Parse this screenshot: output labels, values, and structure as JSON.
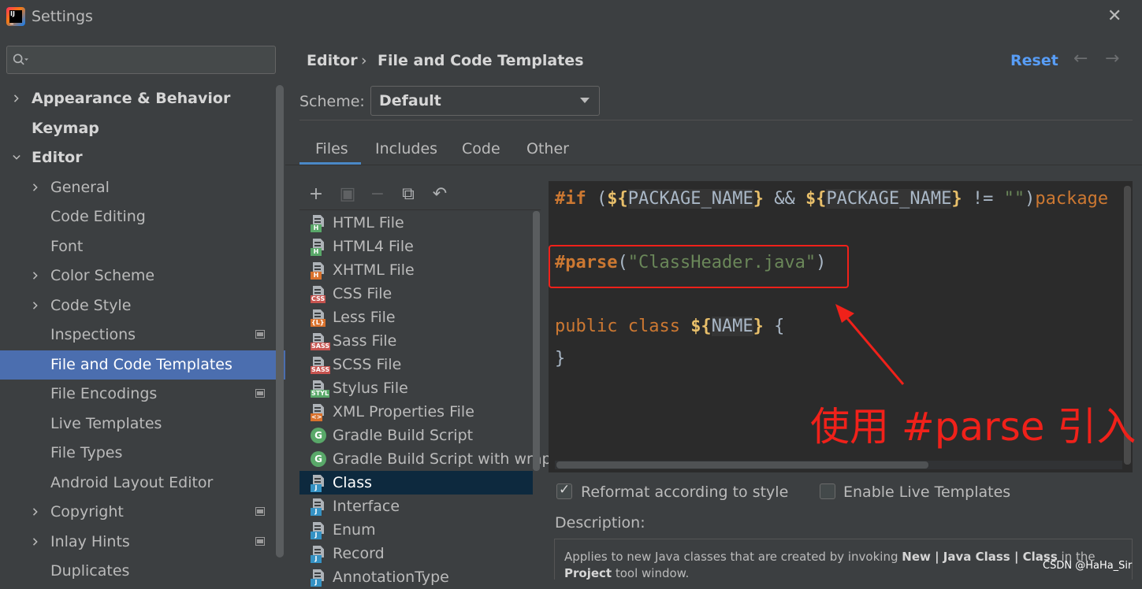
{
  "window": {
    "title": "Settings",
    "close_icon": "close-icon"
  },
  "search": {
    "value": "",
    "icon": "search-icon"
  },
  "sidebar": {
    "items": [
      {
        "label": "Appearance & Behavior",
        "indent": 0,
        "chevron": "right",
        "bold": true,
        "selected": false,
        "project_icon": false
      },
      {
        "label": "Keymap",
        "indent": 0,
        "chevron": "none",
        "bold": true,
        "selected": false,
        "project_icon": false
      },
      {
        "label": "Editor",
        "indent": 0,
        "chevron": "down",
        "bold": true,
        "selected": false,
        "project_icon": false
      },
      {
        "label": "General",
        "indent": 1,
        "chevron": "right",
        "bold": false,
        "selected": false,
        "project_icon": false
      },
      {
        "label": "Code Editing",
        "indent": 1,
        "chevron": "none",
        "bold": false,
        "selected": false,
        "project_icon": false
      },
      {
        "label": "Font",
        "indent": 1,
        "chevron": "none",
        "bold": false,
        "selected": false,
        "project_icon": false
      },
      {
        "label": "Color Scheme",
        "indent": 1,
        "chevron": "right",
        "bold": false,
        "selected": false,
        "project_icon": false
      },
      {
        "label": "Code Style",
        "indent": 1,
        "chevron": "right",
        "bold": false,
        "selected": false,
        "project_icon": false
      },
      {
        "label": "Inspections",
        "indent": 1,
        "chevron": "none",
        "bold": false,
        "selected": false,
        "project_icon": true
      },
      {
        "label": "File and Code Templates",
        "indent": 1,
        "chevron": "none",
        "bold": false,
        "selected": true,
        "project_icon": false
      },
      {
        "label": "File Encodings",
        "indent": 1,
        "chevron": "none",
        "bold": false,
        "selected": false,
        "project_icon": true
      },
      {
        "label": "Live Templates",
        "indent": 1,
        "chevron": "none",
        "bold": false,
        "selected": false,
        "project_icon": false
      },
      {
        "label": "File Types",
        "indent": 1,
        "chevron": "none",
        "bold": false,
        "selected": false,
        "project_icon": false
      },
      {
        "label": "Android Layout Editor",
        "indent": 1,
        "chevron": "none",
        "bold": false,
        "selected": false,
        "project_icon": false
      },
      {
        "label": "Copyright",
        "indent": 1,
        "chevron": "right",
        "bold": false,
        "selected": false,
        "project_icon": true
      },
      {
        "label": "Inlay Hints",
        "indent": 1,
        "chevron": "right",
        "bold": false,
        "selected": false,
        "project_icon": true
      },
      {
        "label": "Duplicates",
        "indent": 1,
        "chevron": "none",
        "bold": false,
        "selected": false,
        "project_icon": false
      }
    ]
  },
  "breadcrumb": {
    "parent": "Editor",
    "separator": "›",
    "current": "File and Code Templates"
  },
  "header": {
    "reset_label": "Reset",
    "back_icon": "arrow-left-icon",
    "forward_icon": "arrow-right-icon"
  },
  "scheme": {
    "label": "Scheme:",
    "value": "Default"
  },
  "tabs": [
    {
      "label": "Files",
      "active": true
    },
    {
      "label": "Includes",
      "active": false
    },
    {
      "label": "Code",
      "active": false
    },
    {
      "label": "Other",
      "active": false
    }
  ],
  "toolbar": {
    "buttons": [
      {
        "icon": "add-icon",
        "glyph": "+",
        "enabled": true
      },
      {
        "icon": "create-child-template-icon",
        "glyph": "▣",
        "enabled": false
      },
      {
        "icon": "remove-icon",
        "glyph": "−",
        "enabled": false
      },
      {
        "icon": "copy-icon",
        "glyph": "⧉",
        "enabled": true
      },
      {
        "icon": "reset-to-default-icon",
        "glyph": "↶",
        "enabled": true
      }
    ]
  },
  "templates": [
    {
      "label": "HTML File",
      "icon": "html-file-icon",
      "tag": "H",
      "tag_color": "#59a869",
      "kind": "file",
      "selected": false
    },
    {
      "label": "HTML4 File",
      "icon": "html-file-icon",
      "tag": "H",
      "tag_color": "#59a869",
      "kind": "file",
      "selected": false
    },
    {
      "label": "XHTML File",
      "icon": "xhtml-file-icon",
      "tag": "H",
      "tag_color": "#d9722d",
      "kind": "file",
      "selected": false
    },
    {
      "label": "CSS File",
      "icon": "css-file-icon",
      "tag": "CSS",
      "tag_color": "#c75450",
      "kind": "file",
      "selected": false
    },
    {
      "label": "Less File",
      "icon": "less-file-icon",
      "tag": "{L}",
      "tag_color": "#d9722d",
      "kind": "file",
      "selected": false
    },
    {
      "label": "Sass File",
      "icon": "sass-file-icon",
      "tag": "SASS",
      "tag_color": "#c75450",
      "kind": "file",
      "selected": false
    },
    {
      "label": "SCSS File",
      "icon": "scss-file-icon",
      "tag": "SASS",
      "tag_color": "#c75450",
      "kind": "file",
      "selected": false
    },
    {
      "label": "Stylus File",
      "icon": "stylus-file-icon",
      "tag": "STYL",
      "tag_color": "#59a869",
      "kind": "file",
      "selected": false
    },
    {
      "label": "XML Properties File",
      "icon": "xml-file-icon",
      "tag": "<>",
      "tag_color": "#d9722d",
      "kind": "file",
      "selected": false
    },
    {
      "label": "Gradle Build Script",
      "icon": "gradle-icon",
      "tag": "G",
      "tag_color": "#59a869",
      "kind": "gradle",
      "selected": false
    },
    {
      "label": "Gradle Build Script with wrapp",
      "icon": "gradle-icon",
      "tag": "G",
      "tag_color": "#59a869",
      "kind": "gradle",
      "selected": false
    },
    {
      "label": "Class",
      "icon": "java-file-icon",
      "tag": "J",
      "tag_color": "#3592c4",
      "kind": "file",
      "selected": true
    },
    {
      "label": "Interface",
      "icon": "java-file-icon",
      "tag": "J",
      "tag_color": "#3592c4",
      "kind": "file",
      "selected": false
    },
    {
      "label": "Enum",
      "icon": "java-file-icon",
      "tag": "J",
      "tag_color": "#3592c4",
      "kind": "file",
      "selected": false
    },
    {
      "label": "Record",
      "icon": "java-file-icon",
      "tag": "J",
      "tag_color": "#3592c4",
      "kind": "file",
      "selected": false
    },
    {
      "label": "AnnotationType",
      "icon": "java-file-icon",
      "tag": "J",
      "tag_color": "#3592c4",
      "kind": "file",
      "selected": false
    }
  ],
  "editor": {
    "lines": [
      [
        {
          "t": "#if",
          "c": "dir"
        },
        {
          "t": " (",
          "c": ""
        },
        {
          "t": "${",
          "c": "varb"
        },
        {
          "t": "PACKAGE_NAME",
          "c": "var"
        },
        {
          "t": "}",
          "c": "varb"
        },
        {
          "t": " && ",
          "c": ""
        },
        {
          "t": "${",
          "c": "varb"
        },
        {
          "t": "PACKAGE_NAME",
          "c": "var"
        },
        {
          "t": "}",
          "c": "varb"
        },
        {
          "t": " != ",
          "c": ""
        },
        {
          "t": "\"\"",
          "c": "str"
        },
        {
          "t": ")",
          "c": ""
        },
        {
          "t": "package",
          "c": "kw"
        }
      ],
      [],
      [
        {
          "t": "#parse",
          "c": "dir"
        },
        {
          "t": "(",
          "c": ""
        },
        {
          "t": "\"ClassHeader.java\"",
          "c": "str"
        },
        {
          "t": ")",
          "c": ""
        }
      ],
      [],
      [
        {
          "t": "public class ",
          "c": "kw"
        },
        {
          "t": "${",
          "c": "varb"
        },
        {
          "t": "NAME",
          "c": "var"
        },
        {
          "t": "}",
          "c": "varb"
        },
        {
          "t": " {",
          "c": ""
        }
      ],
      [
        {
          "t": "}",
          "c": ""
        }
      ]
    ]
  },
  "annotation": {
    "text": "使用 #parse 引入",
    "color": "#f0211a"
  },
  "options": {
    "reformat": {
      "label": "Reformat according to style",
      "checked": true
    },
    "live_templates": {
      "label": "Enable Live Templates",
      "checked": false
    }
  },
  "description": {
    "label": "Description:",
    "parts": [
      {
        "t": "Applies to new Java classes that are created by invoking ",
        "b": false
      },
      {
        "t": "New | Java Class | Class",
        "b": true
      },
      {
        "t": " in the ",
        "b": false
      },
      {
        "t": "Project",
        "b": true
      },
      {
        "t": " tool window.",
        "b": false
      }
    ]
  },
  "watermark": "CSDN @HaHa_Sir",
  "colors": {
    "accent": "#4b6eaf",
    "link": "#589df6",
    "annotation": "#f0211a",
    "selected_row": "#0d293e"
  }
}
